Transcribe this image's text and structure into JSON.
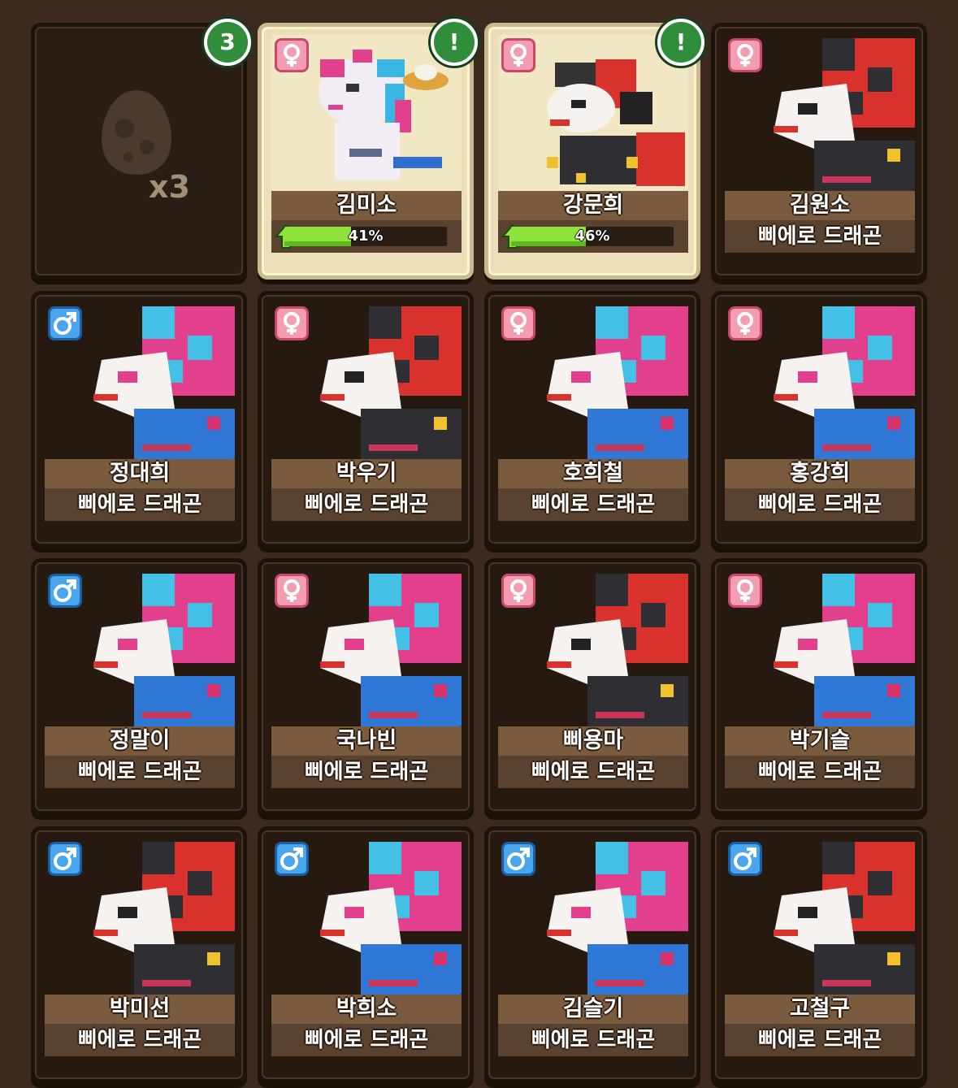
{
  "egg_slot": {
    "badge": "3",
    "count": "x3"
  },
  "hatching": [
    {
      "name": "김미소",
      "gender": "female",
      "progress_label": "41%",
      "progress": 0.41,
      "badge": "!",
      "skin": "pastel"
    },
    {
      "name": "강문희",
      "gender": "female",
      "progress_label": "46%",
      "progress": 0.46,
      "badge": "!",
      "skin": "red"
    }
  ],
  "dragons": [
    {
      "name": "김원소",
      "species": "삐에로 드래곤",
      "gender": "female",
      "skin": "red"
    },
    {
      "name": "정대희",
      "species": "삐에로 드래곤",
      "gender": "male",
      "skin": "blue"
    },
    {
      "name": "박우기",
      "species": "삐에로 드래곤",
      "gender": "female",
      "skin": "red"
    },
    {
      "name": "호희철",
      "species": "삐에로 드래곤",
      "gender": "female",
      "skin": "blue"
    },
    {
      "name": "홍강희",
      "species": "삐에로 드래곤",
      "gender": "female",
      "skin": "blue"
    },
    {
      "name": "정말이",
      "species": "삐에로 드래곤",
      "gender": "male",
      "skin": "blue"
    },
    {
      "name": "국나빈",
      "species": "삐에로 드래곤",
      "gender": "female",
      "skin": "blue"
    },
    {
      "name": "삐용마",
      "species": "삐에로 드래곤",
      "gender": "female",
      "skin": "red"
    },
    {
      "name": "박기슬",
      "species": "삐에로 드래곤",
      "gender": "female",
      "skin": "blue"
    },
    {
      "name": "박미선",
      "species": "삐에로 드래곤",
      "gender": "male",
      "skin": "red"
    },
    {
      "name": "박희소",
      "species": "삐에로 드래곤",
      "gender": "male",
      "skin": "blue"
    },
    {
      "name": "김슬기",
      "species": "삐에로 드래곤",
      "gender": "male",
      "skin": "blue"
    },
    {
      "name": "고철구",
      "species": "삐에로 드래곤",
      "gender": "male",
      "skin": "red"
    }
  ],
  "colors": {
    "background": "#3b2a1d",
    "female": "#f49cb2",
    "male": "#4aa5ef",
    "progress": "#8fe33a",
    "badge": "#2f8d3c"
  }
}
